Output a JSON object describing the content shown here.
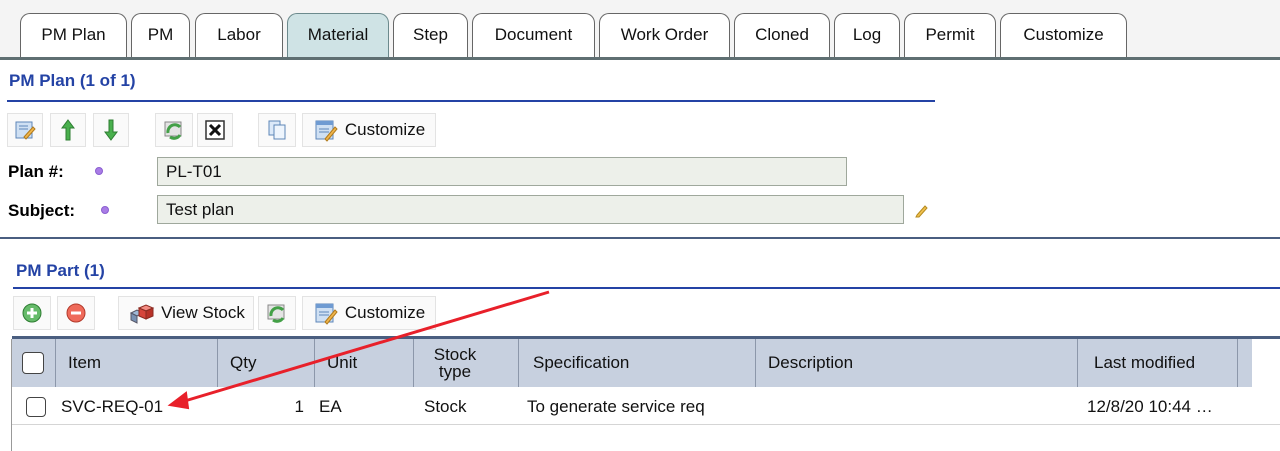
{
  "tabs": [
    {
      "label": "PM Plan",
      "active": false
    },
    {
      "label": "PM",
      "active": false
    },
    {
      "label": "Labor",
      "active": false
    },
    {
      "label": "Material",
      "active": true
    },
    {
      "label": "Step",
      "active": false
    },
    {
      "label": "Document",
      "active": false
    },
    {
      "label": "Work Order",
      "active": false
    },
    {
      "label": "Cloned",
      "active": false
    },
    {
      "label": "Log",
      "active": false
    },
    {
      "label": "Permit",
      "active": false
    },
    {
      "label": "Customize",
      "active": false
    }
  ],
  "plan": {
    "title": "PM Plan (1 of 1)",
    "toolbar": {
      "customize_label": "Customize"
    },
    "fields": {
      "plan_label": "Plan #:",
      "plan_value": "PL-T01",
      "subject_label": "Subject:",
      "subject_value": "Test plan"
    }
  },
  "part": {
    "title": "PM Part (1)",
    "toolbar": {
      "view_stock_label": "View Stock",
      "customize_label": "Customize"
    },
    "columns": [
      "Item",
      "Qty",
      "Unit",
      "Stock type",
      "Specification",
      "Description",
      "Last modified"
    ],
    "rows": [
      {
        "item": "SVC-REQ-01",
        "qty": "1",
        "unit": "EA",
        "stock_type": "Stock",
        "specification": "To generate service req",
        "description": "",
        "last_modified": "12/8/20 10:44 …"
      }
    ]
  },
  "colors": {
    "accent": "#2443a5",
    "active_tab": "#cfe3e5",
    "header_bg": "#c7d0df",
    "annotation": "#e8202a"
  }
}
